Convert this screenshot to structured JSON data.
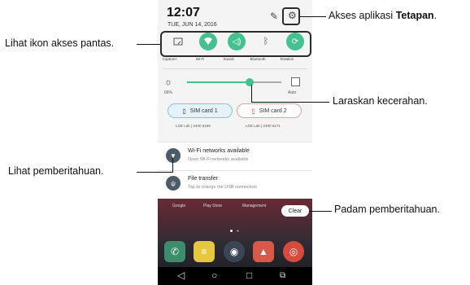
{
  "status": {
    "time": "12:07",
    "date": "TUE, JUN 14, 2016"
  },
  "quick_settings": [
    {
      "label": "Capture+",
      "icon": "capture-icon",
      "on": false
    },
    {
      "label": "Wi-Fi",
      "icon": "wifi-icon",
      "on": true
    },
    {
      "label": "Sound",
      "icon": "sound-icon",
      "on": true
    },
    {
      "label": "Bluetooth",
      "icon": "bluetooth-icon",
      "on": false
    },
    {
      "label": "Rotation",
      "icon": "rotation-icon",
      "on": true
    }
  ],
  "brightness": {
    "percent_label": "66%",
    "level": 0.66,
    "auto_label": "Auto"
  },
  "sims": [
    {
      "label": "SIM card 1",
      "sub": "LGE Lab | 2400 6159"
    },
    {
      "label": "SIM card 2",
      "sub": "LGE Lab | 2400 6171"
    }
  ],
  "notifications": [
    {
      "title": "Wi-Fi networks available",
      "subtitle": "Open Wi-Fi networks available",
      "icon": "wifi-icon"
    },
    {
      "title": "File transfer",
      "subtitle": "Tap to change the USB connection",
      "icon": "usb-icon"
    }
  ],
  "home_apps": [
    "Google",
    "Play Store",
    "Management"
  ],
  "clear_label": "Clear",
  "dock": [
    {
      "icon": "phone-icon",
      "color": "#3a8e6c"
    },
    {
      "icon": "messages-icon",
      "color": "#e8c740"
    },
    {
      "icon": "camera-icon",
      "color": "#3b4655"
    },
    {
      "icon": "gallery-icon",
      "color": "#d8584a"
    },
    {
      "icon": "chrome-icon",
      "color": "#d84b3c"
    }
  ],
  "callouts": {
    "settings_prefix": "Akses aplikasi ",
    "settings_bold": "Tetapan",
    "settings_suffix": ".",
    "quick_access": "Lihat ikon akses pantas.",
    "brightness": "Laraskan kecerahan.",
    "notifications": "Lihat pemberitahuan.",
    "clear": "Padam pemberitahuan."
  }
}
